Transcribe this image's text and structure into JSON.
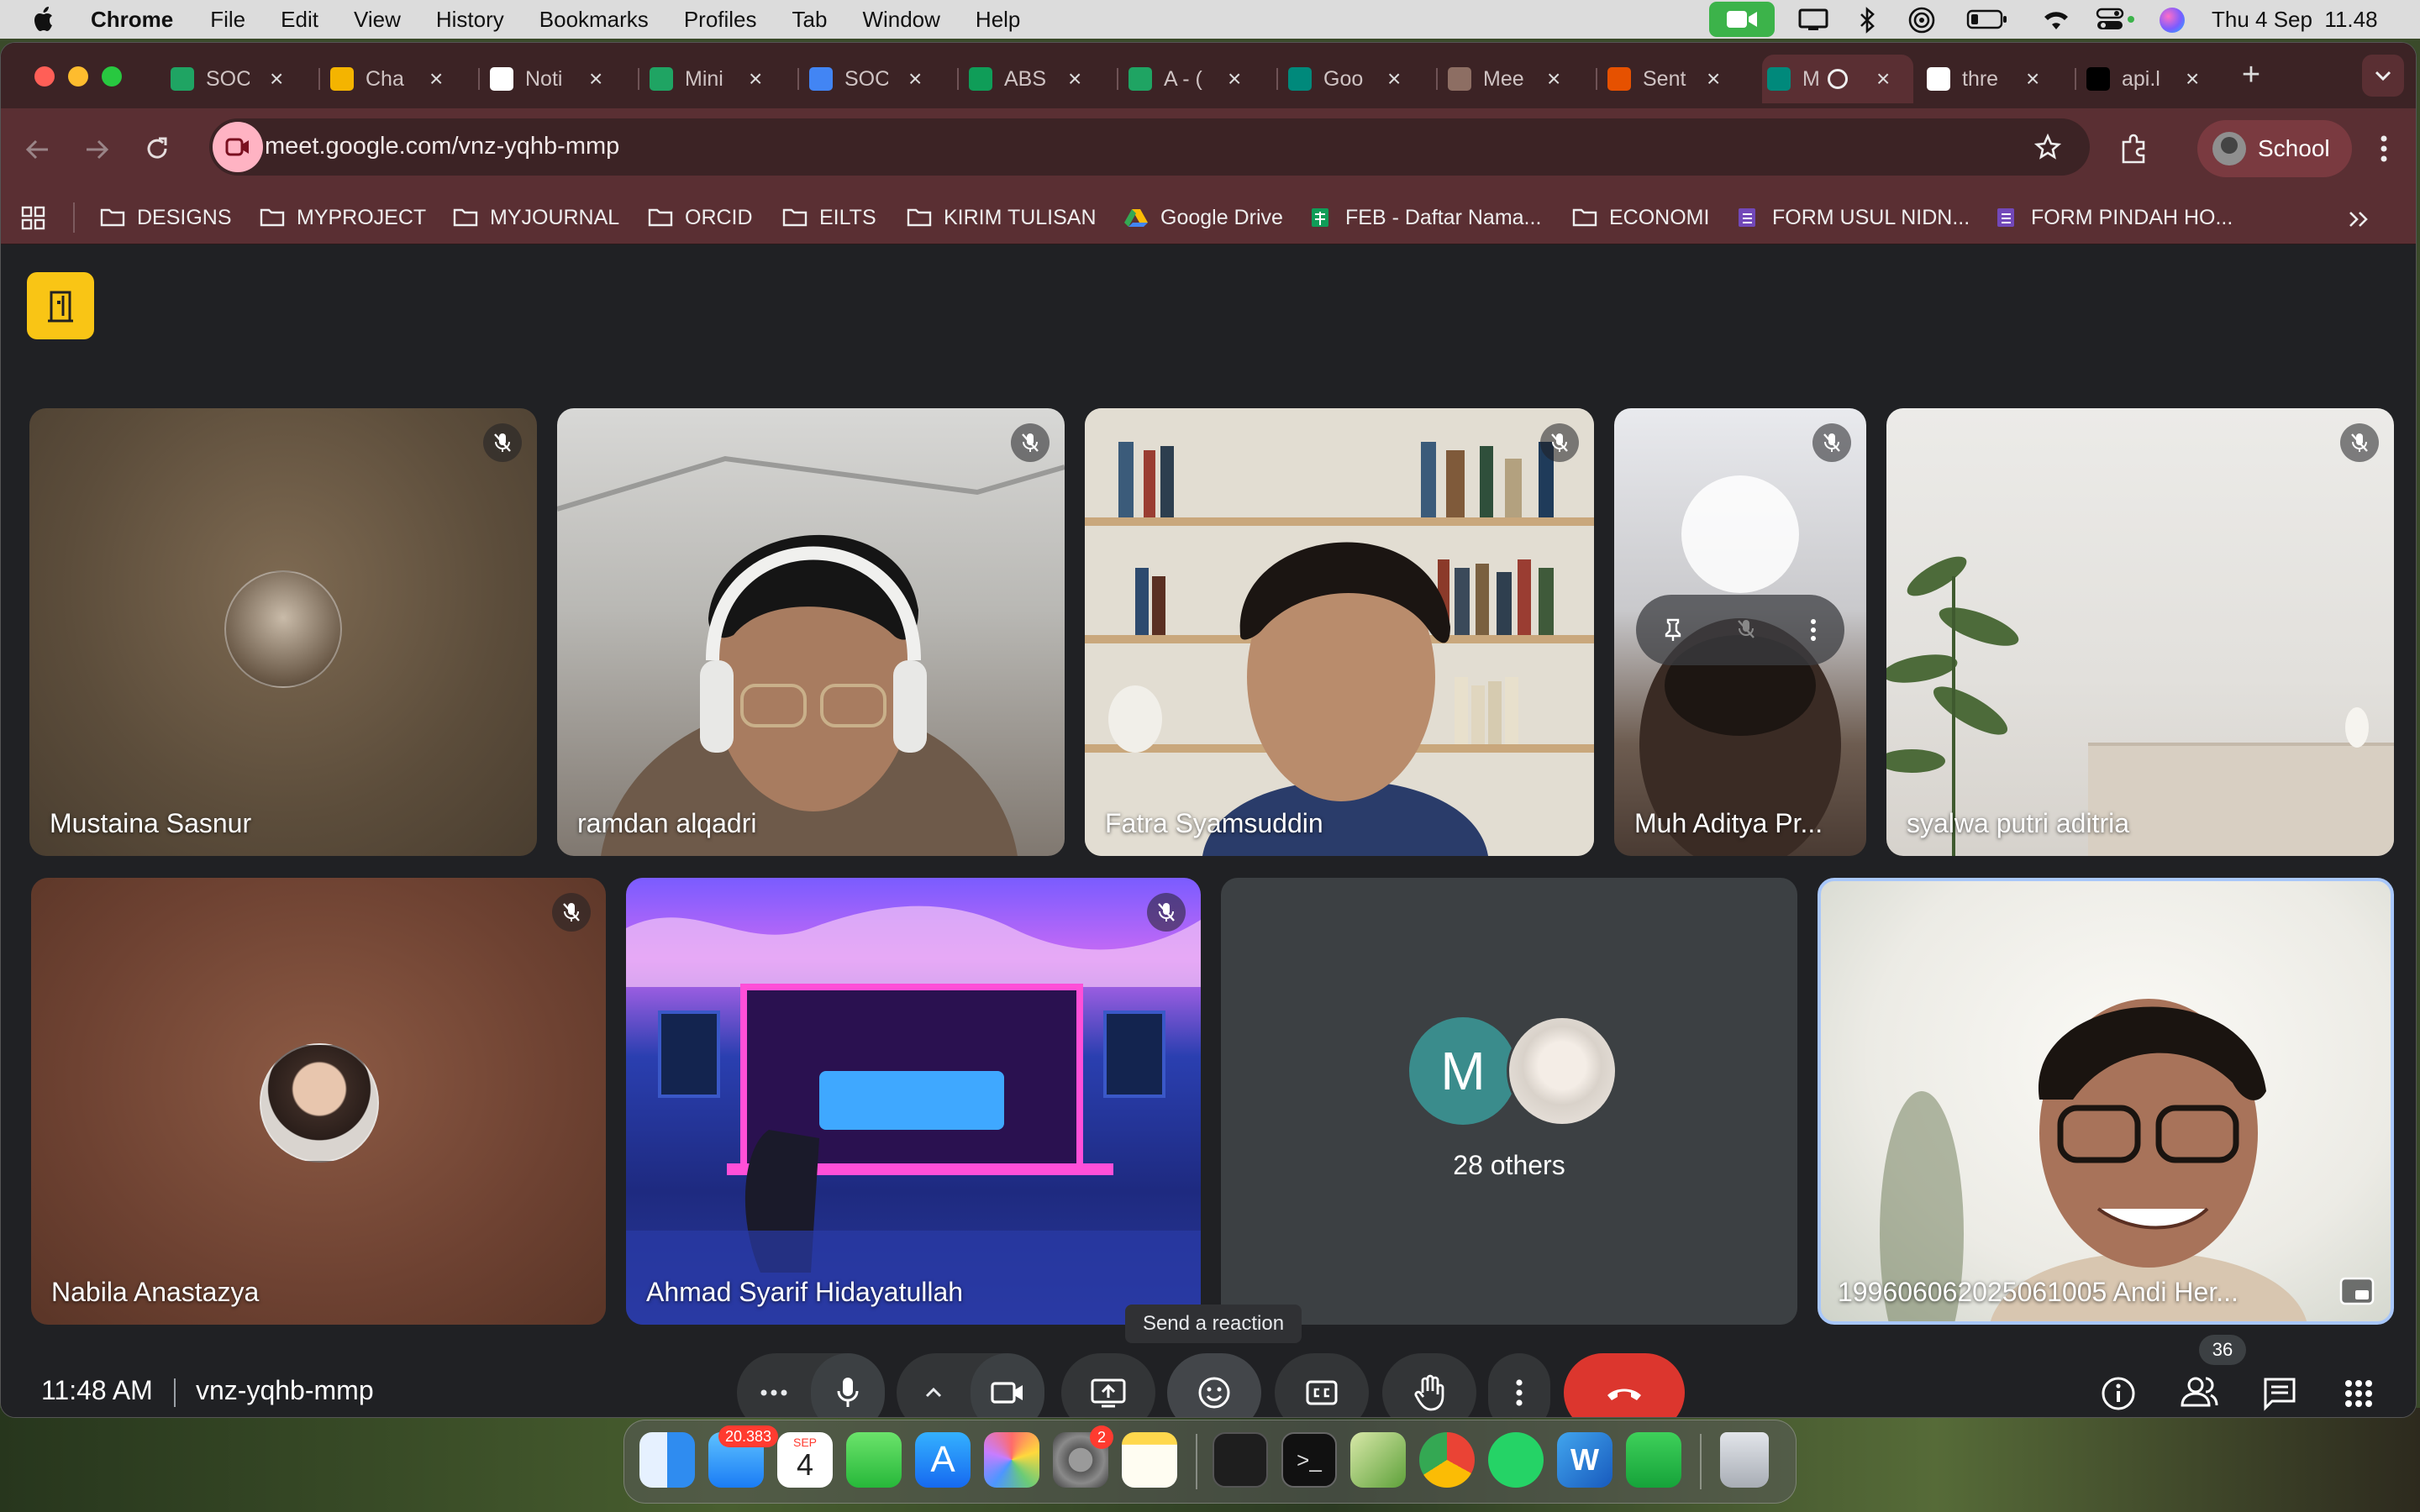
{
  "menubar": {
    "app": "Chrome",
    "menus": [
      "File",
      "Edit",
      "View",
      "History",
      "Bookmarks",
      "Profiles",
      "Tab",
      "Window",
      "Help"
    ],
    "clock": "Thu 4 Sep  11.48"
  },
  "tabs": [
    {
      "title": "SOC",
      "icon": "google-drive-icon",
      "color": "#1fa463"
    },
    {
      "title": "Cha",
      "icon": "slides-icon",
      "color": "#f4b400"
    },
    {
      "title": "Noti",
      "icon": "notion-icon",
      "color": "#ffffff"
    },
    {
      "title": "Mini",
      "icon": "google-drive-icon",
      "color": "#1fa463"
    },
    {
      "title": "SOC",
      "icon": "docs-icon",
      "color": "#4285f4"
    },
    {
      "title": "ABS",
      "icon": "sheets-icon",
      "color": "#0f9d58"
    },
    {
      "title": "A - (",
      "icon": "google-drive-icon",
      "color": "#1fa463"
    },
    {
      "title": "Goo",
      "icon": "meet-icon",
      "color": "#00897b"
    },
    {
      "title": "Mee",
      "icon": "owl-icon",
      "color": "#8d6e63"
    },
    {
      "title": "Sent",
      "icon": "brand-icon",
      "color": "#e65100"
    },
    {
      "title": "M",
      "icon": "meet-icon",
      "color": "#00897b"
    },
    {
      "title": "thre",
      "icon": "google-icon",
      "color": "#ffffff"
    },
    {
      "title": "api.l",
      "icon": "vercel-icon",
      "color": "#000000"
    }
  ],
  "toolbar": {
    "url": "meet.google.com/vnz-yqhb-mmp",
    "profile": "School"
  },
  "bookmarks": [
    "DESIGNS",
    "MYPROJECT",
    "MYJOURNAL",
    "ORCID",
    "EILTS",
    "KIRIM TULISAN",
    "Google Drive",
    "FEB - Daftar Nama...",
    "ECONOMI",
    "FORM USUL NIDN...",
    "FORM PINDAH HO..."
  ],
  "participants": [
    "Mustaina Sasnur",
    "ramdan alqadri",
    "Fatra Syamsuddin",
    "Muh Aditya Pr...",
    "syalwa putri aditria",
    "Nabila Anastazya",
    "Ahmad Syarif Hidayatullah",
    "199606062025061005 Andi Her..."
  ],
  "others": {
    "initial": "M",
    "label": "28 others"
  },
  "meeting": {
    "time": "11:48 AM",
    "code": "vnz-yqhb-mmp"
  },
  "tooltip": "Send a reaction",
  "people_count": "36",
  "dock": {
    "mail_badge": "20.383",
    "calendar_month": "SEP",
    "calendar_day": "4",
    "settings_badge": "2"
  }
}
